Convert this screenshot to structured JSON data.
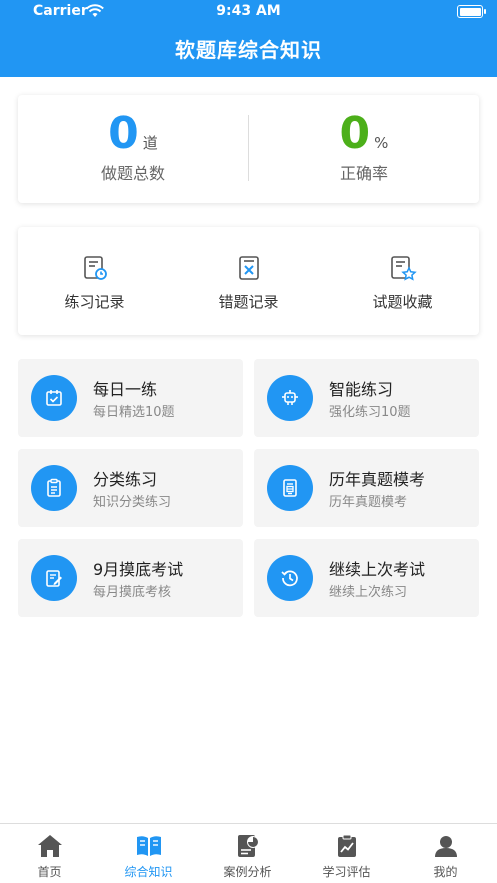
{
  "status": {
    "carrier": "Carrier",
    "time": "9:43 AM"
  },
  "header": {
    "title": "软题库综合知识"
  },
  "stats": {
    "done": {
      "value": "0",
      "unit": "道",
      "label": "做题总数"
    },
    "accuracy": {
      "value": "0",
      "unit": "%",
      "label": "正确率"
    }
  },
  "records": [
    {
      "label": "练习记录",
      "icon": "practice-record-icon"
    },
    {
      "label": "错题记录",
      "icon": "wrong-record-icon"
    },
    {
      "label": "试题收藏",
      "icon": "favorite-icon"
    }
  ],
  "tiles": [
    {
      "title": "每日一练",
      "sub": "每日精选10题",
      "icon": "calendar-check-icon"
    },
    {
      "title": "智能练习",
      "sub": "强化练习10题",
      "icon": "robot-icon"
    },
    {
      "title": "分类练习",
      "sub": "知识分类练习",
      "icon": "clipboard-icon"
    },
    {
      "title": "历年真题模考",
      "sub": "历年真题模考",
      "icon": "exam-paper-icon"
    },
    {
      "title": "9月摸底考试",
      "sub": "每月摸底考核",
      "icon": "edit-note-icon"
    },
    {
      "title": "继续上次考试",
      "sub": "继续上次练习",
      "icon": "history-clock-icon"
    }
  ],
  "tabs": [
    {
      "label": "首页",
      "icon": "home-icon"
    },
    {
      "label": "综合知识",
      "icon": "book-icon"
    },
    {
      "label": "案例分析",
      "icon": "case-analysis-icon"
    },
    {
      "label": "学习评估",
      "icon": "assessment-icon"
    },
    {
      "label": "我的",
      "icon": "user-icon"
    }
  ],
  "colors": {
    "primary": "#2196f3",
    "accuracy": "#4caf1a",
    "tileBg": "#f4f4f4"
  }
}
